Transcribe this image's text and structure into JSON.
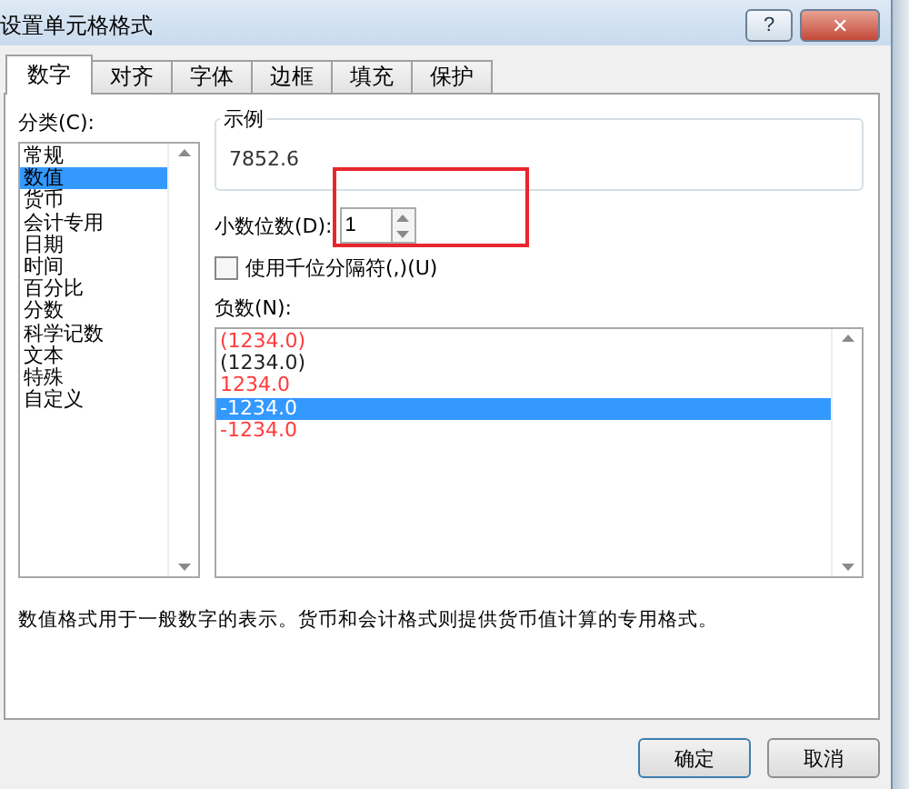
{
  "window": {
    "title": "设置单元格格式",
    "help_button": "?",
    "close_button": "✕"
  },
  "tabs": [
    {
      "label": "数字",
      "selected": true
    },
    {
      "label": "对齐",
      "selected": false
    },
    {
      "label": "字体",
      "selected": false
    },
    {
      "label": "边框",
      "selected": false
    },
    {
      "label": "填充",
      "selected": false
    },
    {
      "label": "保护",
      "selected": false
    }
  ],
  "category": {
    "label": "分类(C):",
    "items": [
      {
        "label": "常规",
        "selected": false
      },
      {
        "label": "数值",
        "selected": true
      },
      {
        "label": "货币",
        "selected": false
      },
      {
        "label": "会计专用",
        "selected": false
      },
      {
        "label": "日期",
        "selected": false
      },
      {
        "label": "时间",
        "selected": false
      },
      {
        "label": "百分比",
        "selected": false
      },
      {
        "label": "分数",
        "selected": false
      },
      {
        "label": "科学记数",
        "selected": false
      },
      {
        "label": "文本",
        "selected": false
      },
      {
        "label": "特殊",
        "selected": false
      },
      {
        "label": "自定义",
        "selected": false
      }
    ]
  },
  "sample": {
    "label": "示例",
    "value": "7852.6"
  },
  "decimal_places": {
    "label": "小数位数(D):",
    "value": "1"
  },
  "thousands_separator": {
    "label": "使用千位分隔符(,)(U)",
    "checked": false
  },
  "negative_numbers": {
    "label": "负数(N):",
    "items": [
      {
        "label": "(1234.0)",
        "kind": "red",
        "selected": false
      },
      {
        "label": "(1234.0)",
        "kind": "plain",
        "selected": false
      },
      {
        "label": "1234.0",
        "kind": "red",
        "selected": false
      },
      {
        "label": "-1234.0",
        "kind": "plain",
        "selected": true
      },
      {
        "label": "-1234.0",
        "kind": "red",
        "selected": false
      }
    ]
  },
  "description": "数值格式用于一般数字的表示。货币和会计格式则提供货币值计算的专用格式。",
  "buttons": [
    "确定",
    "取消"
  ]
}
